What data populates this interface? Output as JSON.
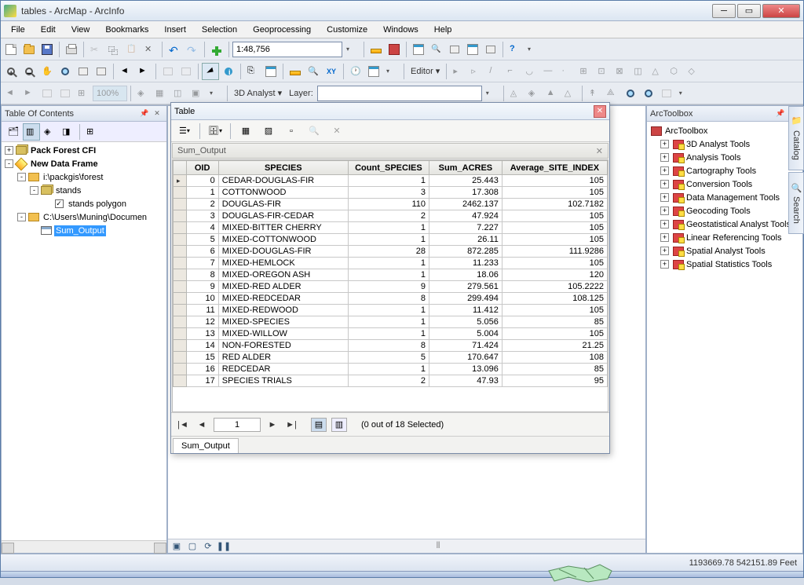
{
  "window": {
    "title": "tables - ArcMap - ArcInfo"
  },
  "menu": {
    "items": [
      "File",
      "Edit",
      "View",
      "Bookmarks",
      "Insert",
      "Selection",
      "Geoprocessing",
      "Customize",
      "Windows",
      "Help"
    ]
  },
  "scale": "1:48,756",
  "analyst_label": "3D Analyst ▾",
  "layer_label": "Layer:",
  "editor_label": "Editor ▾",
  "toc": {
    "title": "Table Of Contents",
    "items": [
      {
        "indent": 0,
        "expand": "+",
        "icon": "stack",
        "label": "Pack Forest CFI",
        "bold": true
      },
      {
        "indent": 0,
        "expand": "-",
        "icon": "diamond",
        "label": "New Data Frame",
        "bold": true
      },
      {
        "indent": 1,
        "expand": "-",
        "icon": "folder",
        "label": "i:\\packgis\\forest"
      },
      {
        "indent": 2,
        "expand": "-",
        "icon": "stack",
        "label": "stands"
      },
      {
        "indent": 3,
        "expand": "",
        "icon": "check",
        "label": "stands polygon"
      },
      {
        "indent": 1,
        "expand": "-",
        "icon": "folder",
        "label": "C:\\Users\\Muning\\Documen"
      },
      {
        "indent": 2,
        "expand": "",
        "icon": "table",
        "label": "Sum_Output",
        "selected": true
      }
    ]
  },
  "arctoolbox": {
    "title": "ArcToolbox",
    "root": "ArcToolbox",
    "items": [
      "3D Analyst Tools",
      "Analysis Tools",
      "Cartography Tools",
      "Conversion Tools",
      "Data Management Tools",
      "Geocoding Tools",
      "Geostatistical Analyst Tools",
      "Linear Referencing Tools",
      "Spatial Analyst Tools",
      "Spatial Statistics Tools"
    ]
  },
  "side_tabs": [
    "Catalog",
    "Search"
  ],
  "table": {
    "title": "Table",
    "sub": "Sum_Output",
    "columns": [
      "OID",
      "SPECIES",
      "Count_SPECIES",
      "Sum_ACRES",
      "Average_SITE_INDEX"
    ],
    "rows": [
      [
        "0",
        "CEDAR-DOUGLAS-FIR",
        "1",
        "25.443",
        "105"
      ],
      [
        "1",
        "COTTONWOOD",
        "3",
        "17.308",
        "105"
      ],
      [
        "2",
        "DOUGLAS-FIR",
        "110",
        "2462.137",
        "102.7182"
      ],
      [
        "3",
        "DOUGLAS-FIR-CEDAR",
        "2",
        "47.924",
        "105"
      ],
      [
        "4",
        "MIXED-BITTER CHERRY",
        "1",
        "7.227",
        "105"
      ],
      [
        "5",
        "MIXED-COTTONWOOD",
        "1",
        "26.11",
        "105"
      ],
      [
        "6",
        "MIXED-DOUGLAS-FIR",
        "28",
        "872.285",
        "111.9286"
      ],
      [
        "7",
        "MIXED-HEMLOCK",
        "1",
        "11.233",
        "105"
      ],
      [
        "8",
        "MIXED-OREGON ASH",
        "1",
        "18.06",
        "120"
      ],
      [
        "9",
        "MIXED-RED ALDER",
        "9",
        "279.561",
        "105.2222"
      ],
      [
        "10",
        "MIXED-REDCEDAR",
        "8",
        "299.494",
        "108.125"
      ],
      [
        "11",
        "MIXED-REDWOOD",
        "1",
        "11.412",
        "105"
      ],
      [
        "12",
        "MIXED-SPECIES",
        "1",
        "5.056",
        "85"
      ],
      [
        "13",
        "MIXED-WILLOW",
        "1",
        "5.004",
        "105"
      ],
      [
        "14",
        "NON-FORESTED",
        "8",
        "71.424",
        "21.25"
      ],
      [
        "15",
        "RED ALDER",
        "5",
        "170.647",
        "108"
      ],
      [
        "16",
        "REDCEDAR",
        "1",
        "13.096",
        "85"
      ],
      [
        "17",
        "SPECIES TRIALS",
        "2",
        "47.93",
        "95"
      ]
    ],
    "nav_record": "1",
    "nav_status": "(0 out of 18 Selected)",
    "tab": "Sum_Output"
  },
  "status": {
    "coords": "1193669.78  542151.89 Feet"
  }
}
